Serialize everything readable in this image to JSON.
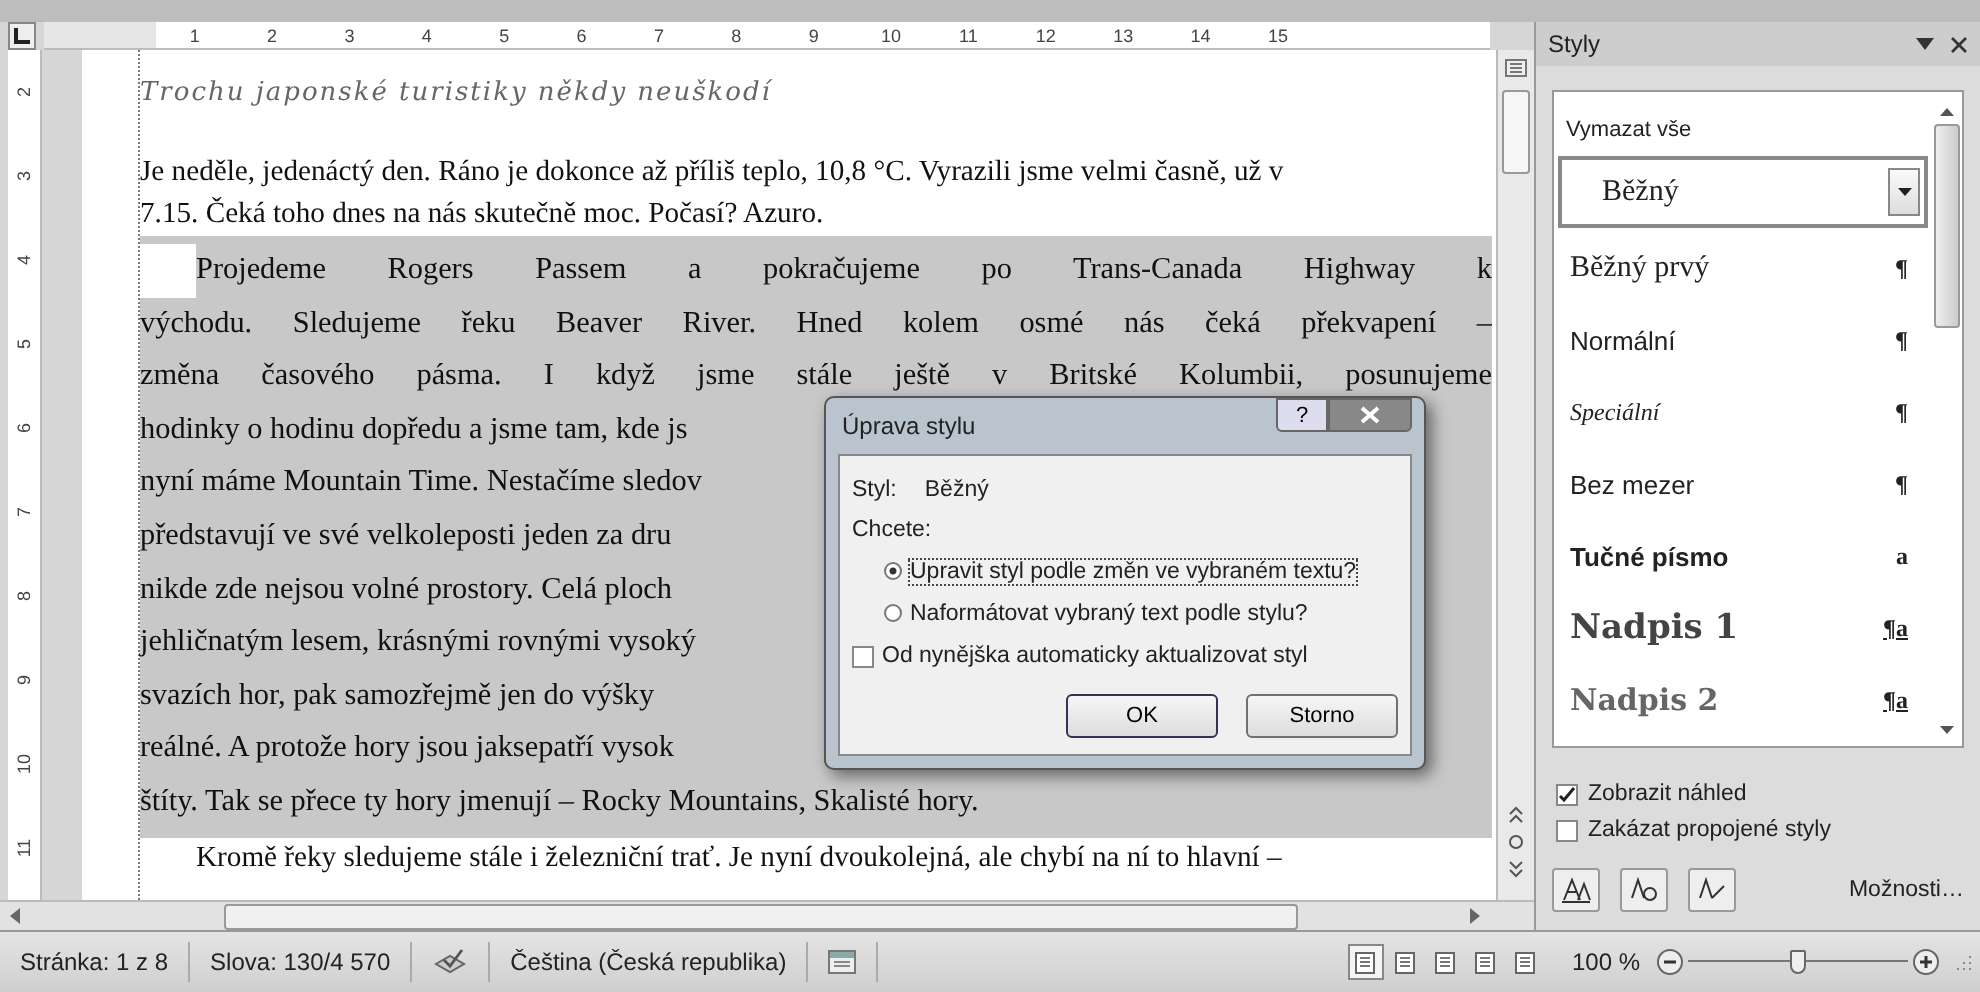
{
  "ruler": {
    "horizontal": [
      "1",
      "2",
      "3",
      "4",
      "5",
      "6",
      "7",
      "8",
      "9",
      "10",
      "11",
      "12",
      "13",
      "14",
      "15"
    ],
    "vertical": [
      "2",
      "3",
      "4",
      "5",
      "6",
      "7",
      "8",
      "9",
      "10",
      "11"
    ]
  },
  "document": {
    "title": "Trochu japonské turistiky někdy neuškodí",
    "paragraphs": [
      {
        "selected": false,
        "lines": [
          {
            "text": "Je neděle, jedenáctý den. Ráno je dokonce až příliš teplo, 10,8 °C. Vyrazili jsme velmi časně, už v",
            "kind": "end"
          },
          {
            "text": "7.15. Čeká toho dnes na nás skutečně moc. Počasí? Azuro.",
            "kind": "end"
          }
        ]
      },
      {
        "selected": true,
        "lines": [
          {
            "text": "Projedeme Rogers Passem a pokračujeme po Trans-Canada Highway k",
            "kind": "full"
          },
          {
            "text": "východu. Sledujeme řeku Beaver River. Hned kolem osmé nás čeká překvapení –",
            "kind": "full"
          },
          {
            "text": "změna časového pásma. I když jsme stále ještě v Britské Kolumbii, posunujeme",
            "kind": "full"
          },
          {
            "text": "hodinky o hodinu dopředu a jsme tam, kde js",
            "kind": "end"
          },
          {
            "text": "nyní máme Mountain Time. Nestačíme sledov",
            "kind": "end"
          },
          {
            "text": "představují ve své velkoleposti jeden za dru",
            "kind": "end"
          },
          {
            "text": "nikde zde nejsou volné prostory. Celá ploch",
            "kind": "end"
          },
          {
            "text": "jehličnatým lesem, krásnými rovnými vysoký",
            "kind": "end"
          },
          {
            "text": "svazích hor, pak samozřejmě jen do výšky",
            "kind": "end"
          },
          {
            "text": "reálné. A protože hory jsou jaksepatří vysok",
            "kind": "end"
          },
          {
            "text": "štíty. Tak se přece ty hory jmenují – Rocky Mountains, Skalisté hory.",
            "kind": "end"
          }
        ]
      },
      {
        "selected": false,
        "lines": [
          {
            "text": "Kromě řeky sledujeme stále i železniční trať. Je nyní dvoukolejná, ale chybí na ní to hlavní –",
            "kind": "end"
          }
        ]
      }
    ]
  },
  "dialog": {
    "title": "Úprava stylu",
    "help": "?",
    "style_label": "Styl:",
    "style_value": "Běžný",
    "question": "Chcete:",
    "choices": [
      {
        "label": "Upravit styl podle změn ve vybraném textu?",
        "selected": true
      },
      {
        "label": "Naformátovat vybraný text podle stylu?",
        "selected": false
      }
    ],
    "auto_update": {
      "label": "Od nynějška automaticky aktualizovat styl",
      "checked": false
    },
    "buttons": [
      "OK",
      "Storno"
    ]
  },
  "styles_pane": {
    "title": "Styly",
    "clear_all": "Vymazat vše",
    "items": [
      {
        "label": "Běžný",
        "kind": "serif",
        "selected": true
      },
      {
        "label": "Běžný prvý",
        "mark": "¶",
        "kind": "serif",
        "selected": false
      },
      {
        "label": "Normální",
        "mark": "¶",
        "kind": "sans",
        "selected": false
      },
      {
        "label": "Speciální",
        "mark": "¶",
        "kind": "italic",
        "selected": false
      },
      {
        "label": "Bez mezer",
        "mark": "¶",
        "kind": "sans",
        "selected": false
      },
      {
        "label": "Tučné písmo",
        "mark": "a",
        "kind": "bold",
        "selected": false
      },
      {
        "label": "Nadpis 1",
        "mark": "¶a",
        "kind": "heading1",
        "selected": false
      },
      {
        "label": "Nadpis 2",
        "mark": "¶a",
        "kind": "heading2",
        "selected": false
      }
    ],
    "options": [
      {
        "label": "Zobrazit náhled",
        "checked": true
      },
      {
        "label": "Zakázat propojené styly",
        "checked": false
      }
    ],
    "options_link": "Možnosti…"
  },
  "status_bar": {
    "page": "Stránka: 1 z 8",
    "words": "Slova: 130/4 570",
    "language": "Čeština (Česká republika)",
    "views": [
      {
        "selected": true
      },
      {
        "selected": false
      },
      {
        "selected": false
      },
      {
        "selected": false
      },
      {
        "selected": false
      }
    ],
    "zoom": "100 %",
    "zoom_slider": {
      "level": 0.5
    }
  }
}
